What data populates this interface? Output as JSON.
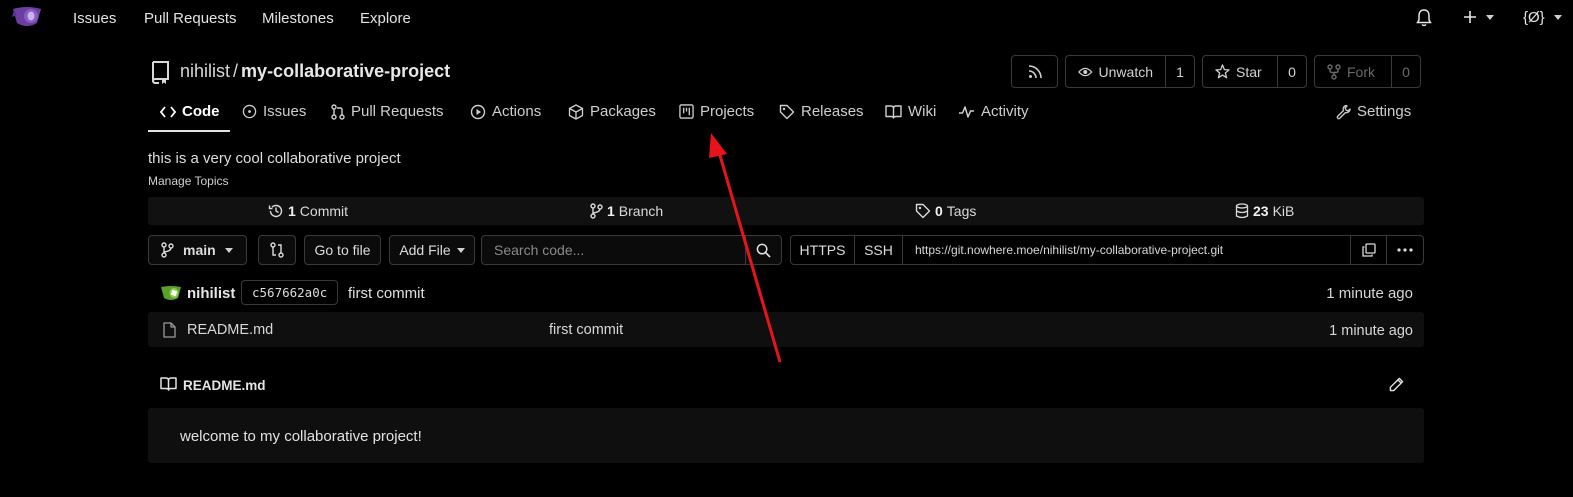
{
  "topnav": {
    "links": [
      "Issues",
      "Pull Requests",
      "Milestones",
      "Explore"
    ],
    "user_label": "{Ø}"
  },
  "repo": {
    "owner": "nihilist",
    "separator": "/",
    "name": "my-collaborative-project",
    "watch_label": "Unwatch",
    "watch_count": "1",
    "star_label": "Star",
    "star_count": "0",
    "fork_label": "Fork",
    "fork_count": "0"
  },
  "tabs": [
    {
      "label": "Code",
      "icon": "code-icon",
      "active": true
    },
    {
      "label": "Issues",
      "icon": "issue-icon"
    },
    {
      "label": "Pull Requests",
      "icon": "pull-request-icon"
    },
    {
      "label": "Actions",
      "icon": "play-icon"
    },
    {
      "label": "Packages",
      "icon": "package-icon"
    },
    {
      "label": "Projects",
      "icon": "project-icon"
    },
    {
      "label": "Releases",
      "icon": "tag-icon"
    },
    {
      "label": "Wiki",
      "icon": "book-icon"
    },
    {
      "label": "Activity",
      "icon": "pulse-icon"
    },
    {
      "label": "Settings",
      "icon": "tools-icon"
    }
  ],
  "description": "this is a very cool collaborative project",
  "manage_topics": "Manage Topics",
  "stats": {
    "commits_count": "1",
    "commits_label": "Commit",
    "branches_count": "1",
    "branches_label": "Branch",
    "tags_count": "0",
    "tags_label": "Tags",
    "size_value": "23",
    "size_unit": "KiB"
  },
  "toolbar": {
    "branch": "main",
    "go_to_file": "Go to file",
    "add_file": "Add File",
    "search_placeholder": "Search code...",
    "https": "HTTPS",
    "ssh": "SSH",
    "clone_url": "https://git.nowhere.moe/nihilist/my-collaborative-project.git"
  },
  "latest_commit": {
    "author": "nihilist",
    "sha": "c567662a0c",
    "message": "first commit",
    "time": "1 minute ago"
  },
  "files": [
    {
      "name": "README.md",
      "message": "first commit",
      "time": "1 minute ago"
    }
  ],
  "readme": {
    "title": "README.md",
    "content": "welcome to my collaborative project!"
  },
  "annotation": {
    "color": "#e8141c"
  }
}
